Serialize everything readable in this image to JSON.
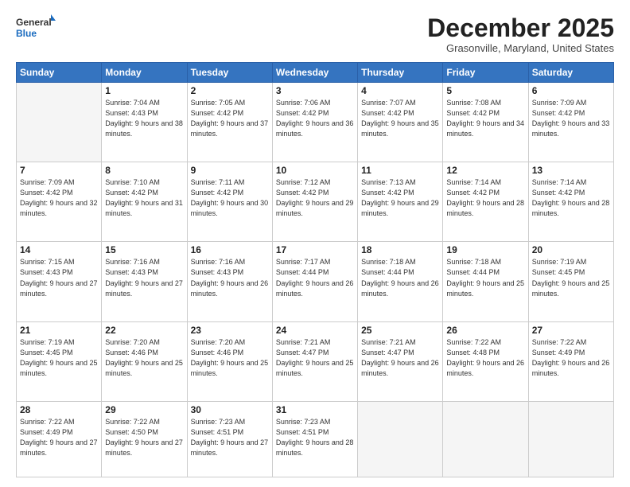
{
  "logo": {
    "general": "General",
    "blue": "Blue"
  },
  "header": {
    "month": "December 2025",
    "location": "Grasonville, Maryland, United States"
  },
  "days_of_week": [
    "Sunday",
    "Monday",
    "Tuesday",
    "Wednesday",
    "Thursday",
    "Friday",
    "Saturday"
  ],
  "weeks": [
    [
      {
        "day": "",
        "empty": true
      },
      {
        "day": "1",
        "sunrise": "7:04 AM",
        "sunset": "4:43 PM",
        "daylight": "9 hours and 38 minutes."
      },
      {
        "day": "2",
        "sunrise": "7:05 AM",
        "sunset": "4:42 PM",
        "daylight": "9 hours and 37 minutes."
      },
      {
        "day": "3",
        "sunrise": "7:06 AM",
        "sunset": "4:42 PM",
        "daylight": "9 hours and 36 minutes."
      },
      {
        "day": "4",
        "sunrise": "7:07 AM",
        "sunset": "4:42 PM",
        "daylight": "9 hours and 35 minutes."
      },
      {
        "day": "5",
        "sunrise": "7:08 AM",
        "sunset": "4:42 PM",
        "daylight": "9 hours and 34 minutes."
      },
      {
        "day": "6",
        "sunrise": "7:09 AM",
        "sunset": "4:42 PM",
        "daylight": "9 hours and 33 minutes."
      }
    ],
    [
      {
        "day": "7",
        "sunrise": "7:09 AM",
        "sunset": "4:42 PM",
        "daylight": "9 hours and 32 minutes."
      },
      {
        "day": "8",
        "sunrise": "7:10 AM",
        "sunset": "4:42 PM",
        "daylight": "9 hours and 31 minutes."
      },
      {
        "day": "9",
        "sunrise": "7:11 AM",
        "sunset": "4:42 PM",
        "daylight": "9 hours and 30 minutes."
      },
      {
        "day": "10",
        "sunrise": "7:12 AM",
        "sunset": "4:42 PM",
        "daylight": "9 hours and 29 minutes."
      },
      {
        "day": "11",
        "sunrise": "7:13 AM",
        "sunset": "4:42 PM",
        "daylight": "9 hours and 29 minutes."
      },
      {
        "day": "12",
        "sunrise": "7:14 AM",
        "sunset": "4:42 PM",
        "daylight": "9 hours and 28 minutes."
      },
      {
        "day": "13",
        "sunrise": "7:14 AM",
        "sunset": "4:42 PM",
        "daylight": "9 hours and 28 minutes."
      }
    ],
    [
      {
        "day": "14",
        "sunrise": "7:15 AM",
        "sunset": "4:43 PM",
        "daylight": "9 hours and 27 minutes."
      },
      {
        "day": "15",
        "sunrise": "7:16 AM",
        "sunset": "4:43 PM",
        "daylight": "9 hours and 27 minutes."
      },
      {
        "day": "16",
        "sunrise": "7:16 AM",
        "sunset": "4:43 PM",
        "daylight": "9 hours and 26 minutes."
      },
      {
        "day": "17",
        "sunrise": "7:17 AM",
        "sunset": "4:44 PM",
        "daylight": "9 hours and 26 minutes."
      },
      {
        "day": "18",
        "sunrise": "7:18 AM",
        "sunset": "4:44 PM",
        "daylight": "9 hours and 26 minutes."
      },
      {
        "day": "19",
        "sunrise": "7:18 AM",
        "sunset": "4:44 PM",
        "daylight": "9 hours and 25 minutes."
      },
      {
        "day": "20",
        "sunrise": "7:19 AM",
        "sunset": "4:45 PM",
        "daylight": "9 hours and 25 minutes."
      }
    ],
    [
      {
        "day": "21",
        "sunrise": "7:19 AM",
        "sunset": "4:45 PM",
        "daylight": "9 hours and 25 minutes."
      },
      {
        "day": "22",
        "sunrise": "7:20 AM",
        "sunset": "4:46 PM",
        "daylight": "9 hours and 25 minutes."
      },
      {
        "day": "23",
        "sunrise": "7:20 AM",
        "sunset": "4:46 PM",
        "daylight": "9 hours and 25 minutes."
      },
      {
        "day": "24",
        "sunrise": "7:21 AM",
        "sunset": "4:47 PM",
        "daylight": "9 hours and 25 minutes."
      },
      {
        "day": "25",
        "sunrise": "7:21 AM",
        "sunset": "4:47 PM",
        "daylight": "9 hours and 26 minutes."
      },
      {
        "day": "26",
        "sunrise": "7:22 AM",
        "sunset": "4:48 PM",
        "daylight": "9 hours and 26 minutes."
      },
      {
        "day": "27",
        "sunrise": "7:22 AM",
        "sunset": "4:49 PM",
        "daylight": "9 hours and 26 minutes."
      }
    ],
    [
      {
        "day": "28",
        "sunrise": "7:22 AM",
        "sunset": "4:49 PM",
        "daylight": "9 hours and 27 minutes."
      },
      {
        "day": "29",
        "sunrise": "7:22 AM",
        "sunset": "4:50 PM",
        "daylight": "9 hours and 27 minutes."
      },
      {
        "day": "30",
        "sunrise": "7:23 AM",
        "sunset": "4:51 PM",
        "daylight": "9 hours and 27 minutes."
      },
      {
        "day": "31",
        "sunrise": "7:23 AM",
        "sunset": "4:51 PM",
        "daylight": "9 hours and 28 minutes."
      },
      {
        "day": "",
        "empty": true
      },
      {
        "day": "",
        "empty": true
      },
      {
        "day": "",
        "empty": true
      }
    ]
  ]
}
